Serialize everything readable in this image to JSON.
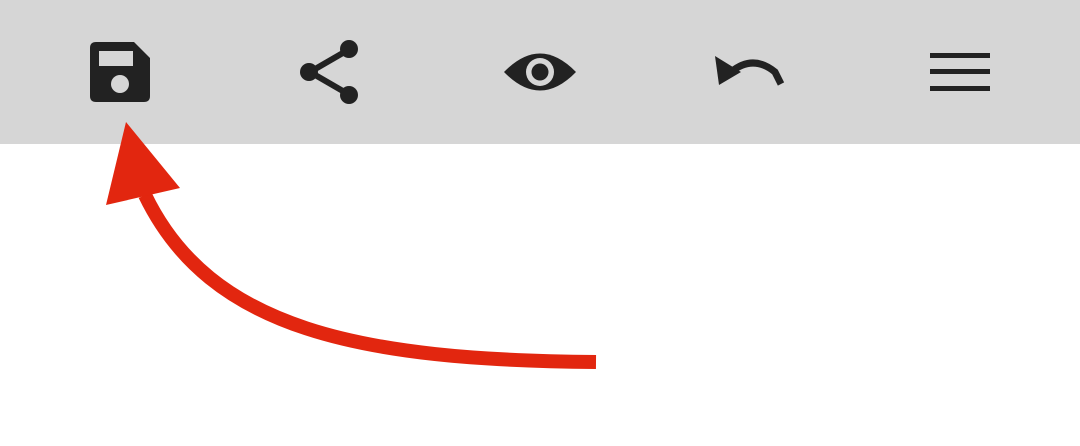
{
  "toolbar": {
    "background": "#d6d6d6",
    "icon_color": "#222222",
    "buttons": [
      {
        "id": "save",
        "icon": "floppy-disk-icon"
      },
      {
        "id": "share",
        "icon": "share-icon"
      },
      {
        "id": "view",
        "icon": "eye-icon"
      },
      {
        "id": "undo",
        "icon": "undo-icon"
      },
      {
        "id": "menu",
        "icon": "hamburger-menu-icon"
      }
    ]
  },
  "annotation": {
    "type": "arrow",
    "points_to": "save",
    "color": "#e2260f"
  }
}
